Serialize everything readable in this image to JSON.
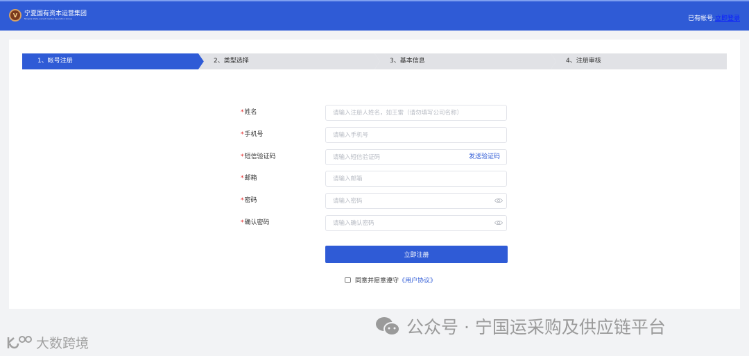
{
  "header": {
    "logo_text": "宁夏国有资本运营集团",
    "logo_subtext": "Ningxia State-owned Capital Operation Group",
    "logo_mark": "V",
    "have_account": "已有帐号,",
    "login_link": "立即登录"
  },
  "steps": [
    {
      "label": "1、帐号注册",
      "active": true
    },
    {
      "label": "2、类型选择",
      "active": false
    },
    {
      "label": "3、基本信息",
      "active": false
    },
    {
      "label": "4、注册审核",
      "active": false
    }
  ],
  "form": {
    "required_mark": "*",
    "fields": [
      {
        "label": "姓名",
        "placeholder": "请输入注册人姓名，如王雷（请勿填写公司名称）",
        "value": ""
      },
      {
        "label": "手机号",
        "placeholder": "请输入手机号",
        "value": ""
      },
      {
        "label": "短信验证码",
        "placeholder": "请输入短信验证码",
        "value": "",
        "action": "发送验证码"
      },
      {
        "label": "邮箱",
        "placeholder": "请输入邮箱",
        "value": ""
      },
      {
        "label": "密码",
        "placeholder": "请输入密码",
        "value": ""
      },
      {
        "label": "确认密码",
        "placeholder": "请输入确认密码",
        "value": ""
      }
    ],
    "submit_label": "立即注册",
    "agree_text": "同意并愿意遵守",
    "agreement_link": "《用户协议》",
    "agree_checked": false
  },
  "watermarks": {
    "wechat": "公众号 · 宁国运采购及供应链平台",
    "brand": "大数跨境"
  },
  "colors": {
    "primary": "#2f5bd6",
    "required": "#e02020"
  }
}
